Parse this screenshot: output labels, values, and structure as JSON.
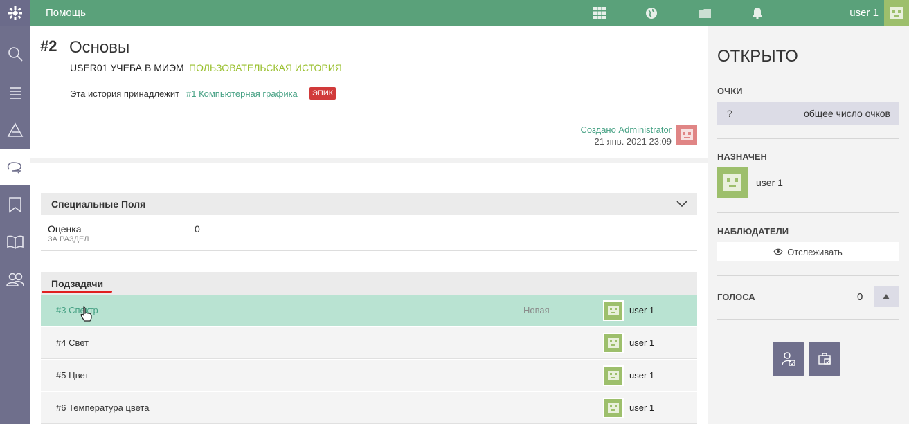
{
  "topbar": {
    "title": "Помощь",
    "username": "user 1",
    "icons": [
      "taiga-logo-icon",
      "apps-grid-icon",
      "globe-icon",
      "folder-icon",
      "bell-icon"
    ]
  },
  "sidebar": {
    "items": [
      "search-icon",
      "backlog-icon",
      "kanban-icon",
      "timeline-icon",
      "issues-icon",
      "wiki-icon",
      "team-icon"
    ]
  },
  "story": {
    "ref": "#2",
    "subject": "Основы",
    "project": "USER01 УЧЕБА В МИЭМ",
    "type": "ПОЛЬЗОВАТЕЛЬСКАЯ ИСТОРИЯ",
    "belongs_text": "Эта история принадлежит",
    "epic_link": "#1 Компьютерная графика",
    "epic_badge": "ЭПИК",
    "created_by": "Создано Administrator",
    "created_date": "21 янв. 2021 23:09"
  },
  "custom_fields": {
    "header": "Специальные Поля",
    "field_name": "Оценка",
    "field_desc": "ЗА РАЗДЕЛ",
    "field_value": "0"
  },
  "subtasks": {
    "header": "Подзадачи",
    "rows": [
      {
        "ref": "#3 Спектр",
        "status": "Новая",
        "user": "user 1"
      },
      {
        "ref": "#4 Свет",
        "status": "",
        "user": "user 1"
      },
      {
        "ref": "#5 Цвет",
        "status": "",
        "user": "user 1"
      },
      {
        "ref": "#6 Температура цвета",
        "status": "",
        "user": "user 1"
      }
    ]
  },
  "right": {
    "status": "ОТКРЫТО",
    "points_title": "ОЧКИ",
    "points_value": "?",
    "points_label": "общее число очков",
    "assigned_title": "НАЗНАЧЕН",
    "assigned_user": "user 1",
    "watchers_title": "НАБЛЮДАТЕЛИ",
    "watch_label": "Отслеживать",
    "votes_title": "ГОЛОСА",
    "votes_count": "0"
  },
  "colors": {
    "topbar": "#5aa17a",
    "sidebar": "#6f6f8c",
    "accent_green": "#46a184",
    "type_green": "#9ac02f",
    "epic_red": "#d13a3a",
    "highlight_row": "#b9e3d2"
  }
}
